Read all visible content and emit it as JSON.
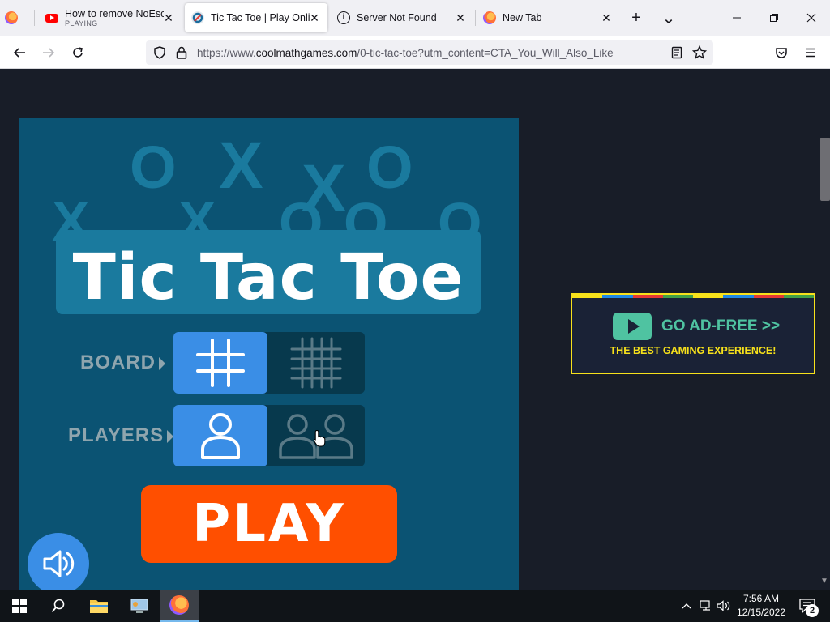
{
  "browser": {
    "tabs": [
      {
        "title": "How to remove NoEscape",
        "subtitle": "PLAYING",
        "icon": "youtube-icon"
      },
      {
        "title": "Tic Tac Toe | Play Online",
        "icon": "coolmath-icon",
        "active": true
      },
      {
        "title": "Server Not Found",
        "icon": "info-icon"
      },
      {
        "title": "New Tab",
        "icon": "firefox-icon"
      }
    ],
    "url": {
      "protocol": "https://www.",
      "host": "coolmathgames.com",
      "path": "/0-tic-tac-toe?utm_content=CTA_You_Will_Also_Like"
    },
    "close_glyph": "✕",
    "new_tab_glyph": "+",
    "list_tabs_glyph": "⌄"
  },
  "game": {
    "title": "Tic Tac Toe",
    "board_label": "BOARD",
    "players_label": "PLAYERS",
    "play_label": "PLAY",
    "board_selected": "3x3",
    "players_selected": "1 player",
    "background_symbols": [
      "O",
      "X",
      "O",
      "X",
      "X",
      "X",
      "O",
      "O",
      "O"
    ]
  },
  "ad": {
    "headline": "GO AD-FREE >>",
    "subline": "THE BEST GAMING EXPERIENCE!",
    "stripe_colors": [
      "#f7e11b",
      "#1e88e5",
      "#e53935",
      "#43a047",
      "#f7e11b",
      "#1e88e5",
      "#e53935",
      "#43a047"
    ]
  },
  "taskbar": {
    "time": "7:56 AM",
    "date": "12/15/2022",
    "notification_count": "2"
  },
  "colors": {
    "page_bg": "#181d28",
    "game_bg": "#0b5373",
    "accent_blue": "#3a8ee6",
    "play_orange": "#ff4f00",
    "ad_yellow": "#f7e11b",
    "ad_green": "#4fc3a1"
  }
}
